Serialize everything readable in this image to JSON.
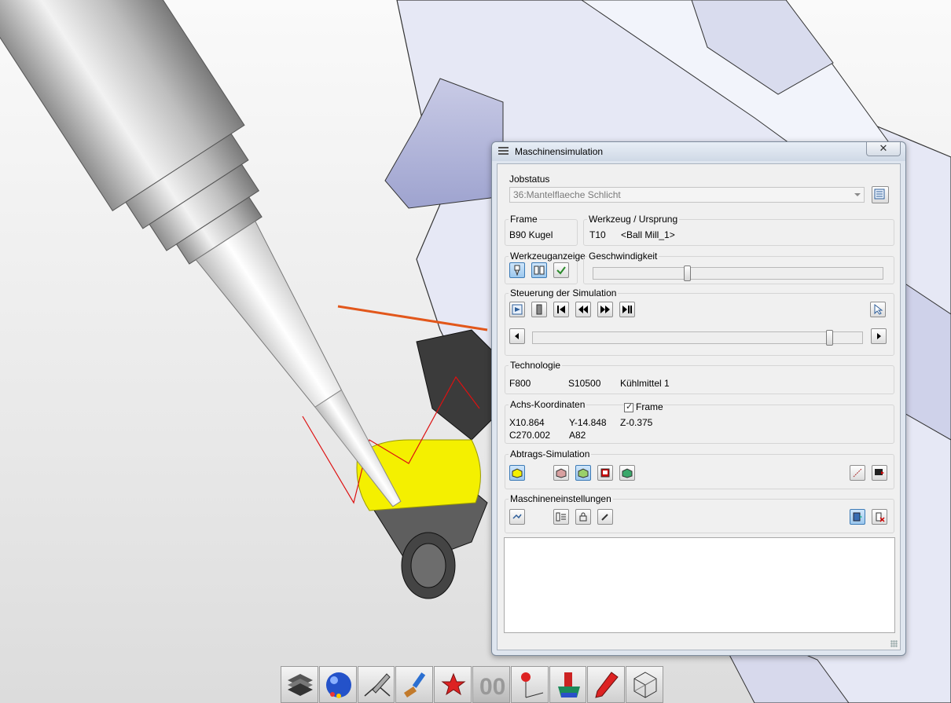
{
  "dialog": {
    "title": "Maschinensimulation",
    "close_label": "✕"
  },
  "jobstatus": {
    "label": "Jobstatus",
    "selected": "36:Mantelflaeche Schlicht"
  },
  "frame": {
    "label": "Frame",
    "value": "B90 Kugel"
  },
  "tool": {
    "label": "Werkzeug / Ursprung",
    "number": "T10",
    "name": "<Ball Mill_1>"
  },
  "tool_display": {
    "label": "Werkzeuganzeige"
  },
  "speed": {
    "label": "Geschwindigkeit",
    "value": 0.32
  },
  "sim_control": {
    "label": "Steuerung der Simulation",
    "progress": 0.91
  },
  "technology": {
    "label": "Technologie",
    "feed": "F800",
    "spindle": "S10500",
    "coolant": "Kühlmittel 1"
  },
  "axis": {
    "label": "Achs-Koordinaten",
    "frame_checkbox_label": "Frame",
    "frame_checked": true,
    "x": "X10.864",
    "y": "Y-14.848",
    "z": "Z-0.375",
    "c": "C270.002",
    "a": "A82"
  },
  "removal": {
    "label": "Abtrags-Simulation"
  },
  "machine_settings": {
    "label": "Maschineneinstellungen"
  },
  "taskbar_icons": [
    "layers-icon",
    "render-sphere-icon",
    "pen-icon",
    "brush-icon",
    "star-icon",
    "digits-icon",
    "axis-pin-icon",
    "paint-bucket-icon",
    "pencil-icon",
    "wireframe-icon"
  ]
}
